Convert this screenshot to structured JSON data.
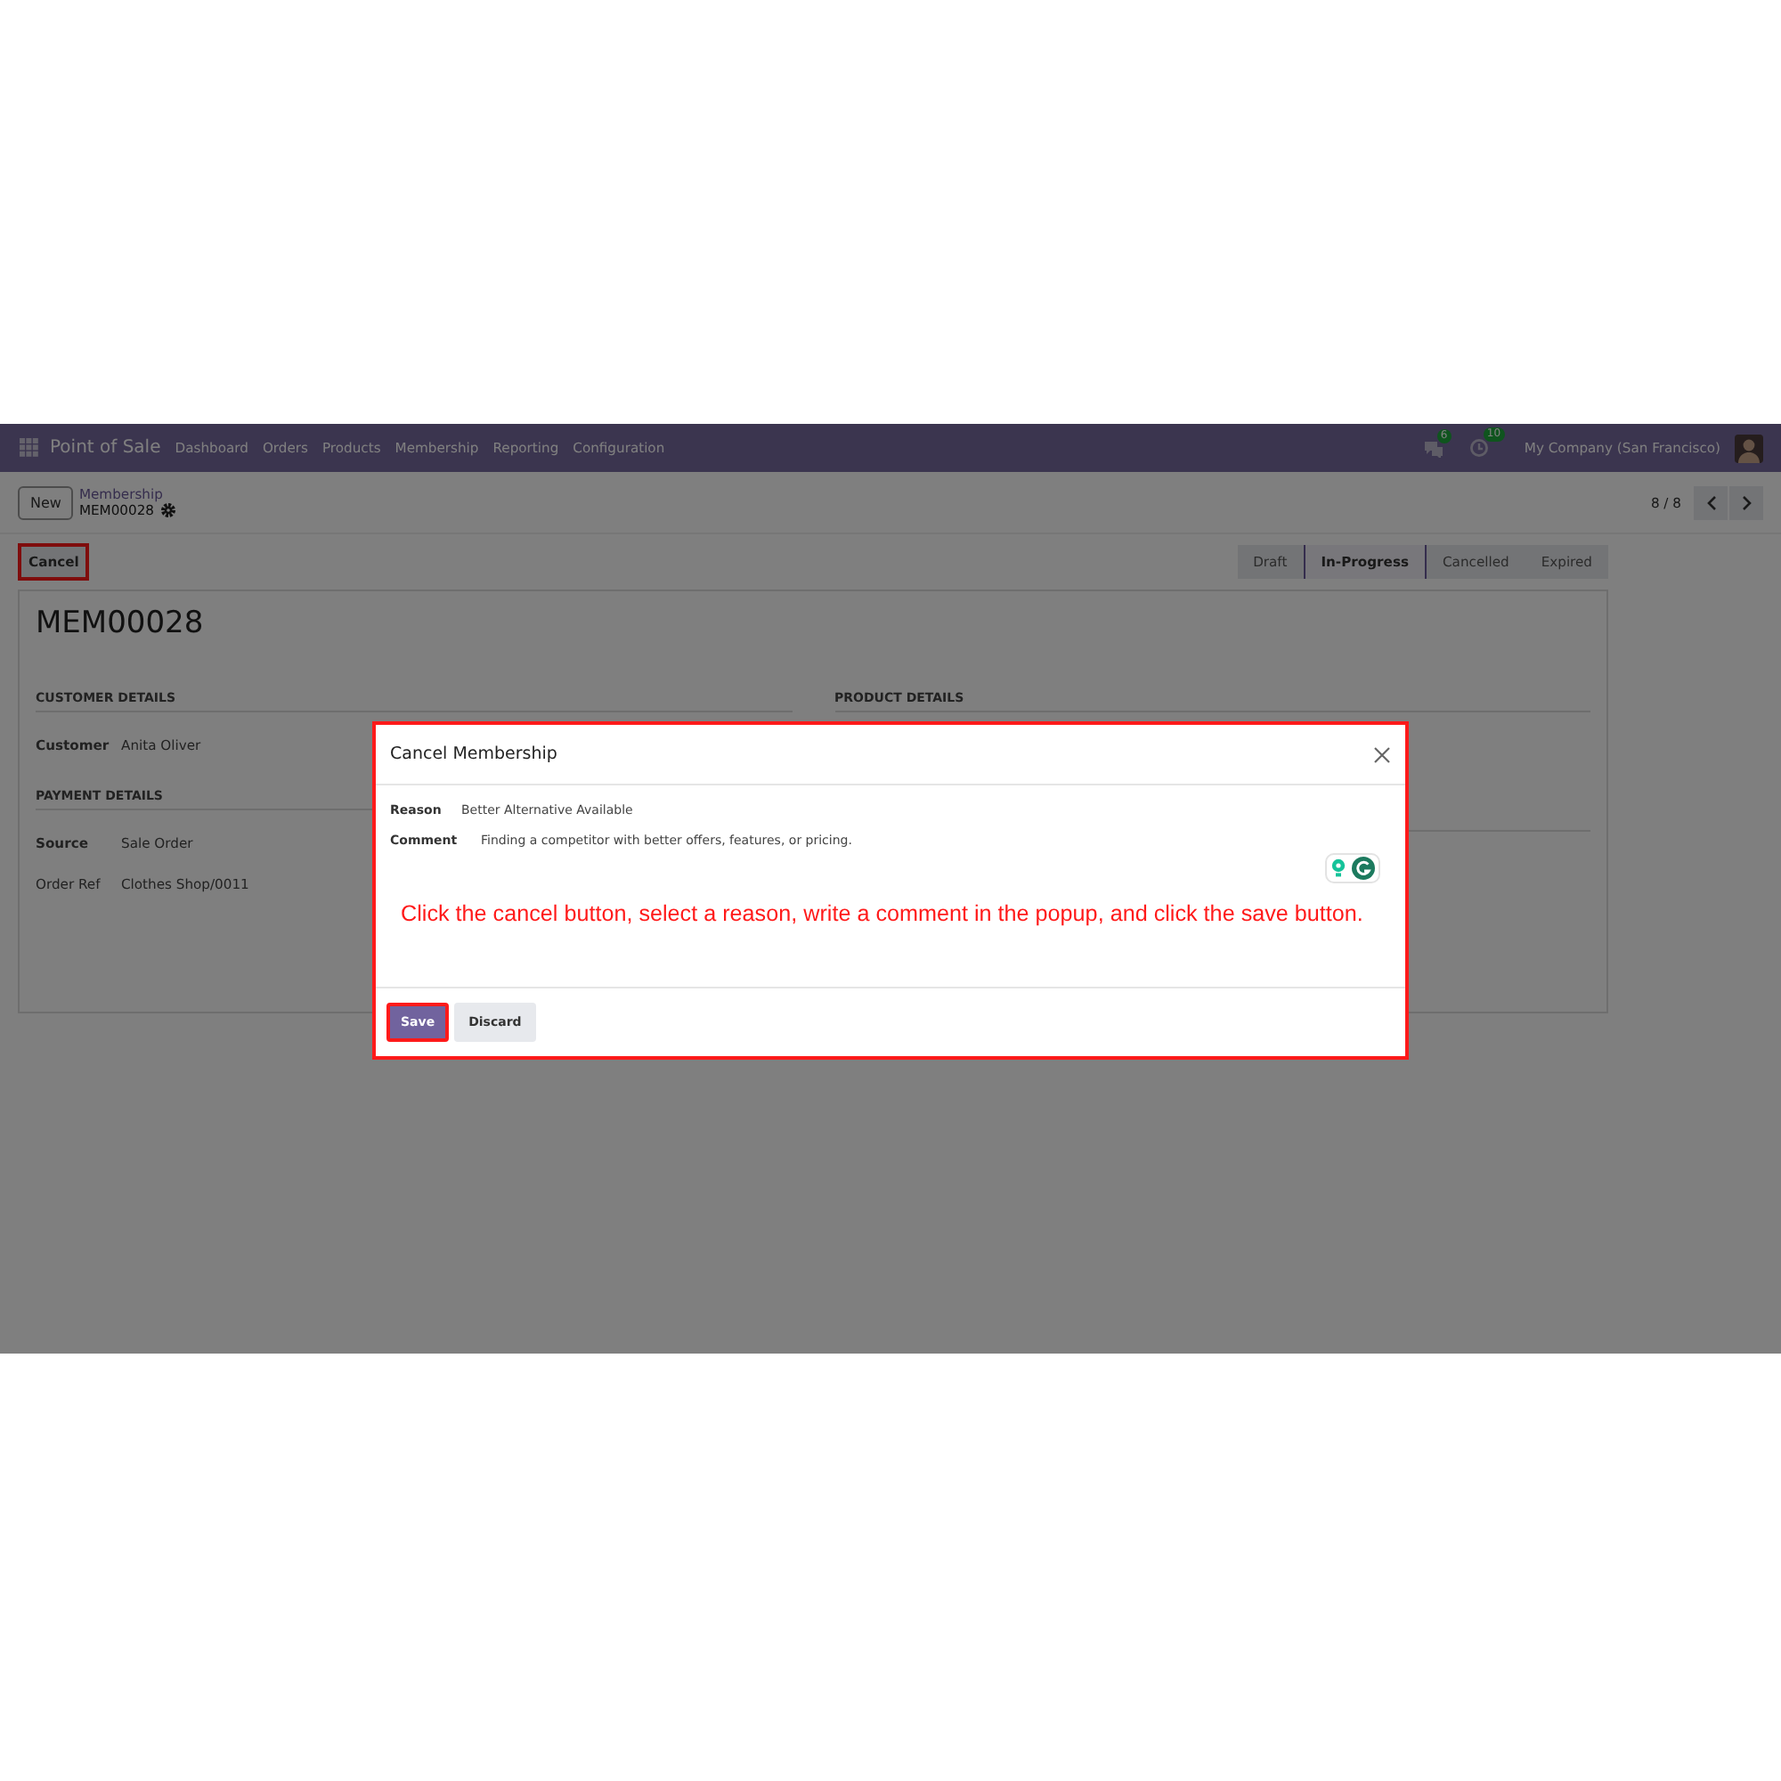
{
  "navbar": {
    "app_name": "Point of Sale",
    "menu": [
      "Dashboard",
      "Orders",
      "Products",
      "Membership",
      "Reporting",
      "Configuration"
    ],
    "messages_count": "6",
    "activities_count": "10",
    "company": "My Company (San Francisco)"
  },
  "control_panel": {
    "new_button": "New",
    "breadcrumb": "Membership",
    "record": "MEM00028",
    "pager": "8 / 8"
  },
  "actions": [
    {
      "label": "Cancel",
      "highlighted": true
    }
  ],
  "statusbar": [
    {
      "label": "Draft",
      "selected": false
    },
    {
      "label": "In-Progress",
      "selected": true
    },
    {
      "label": "Cancelled",
      "selected": false
    },
    {
      "label": "Expired",
      "selected": false
    }
  ],
  "form": {
    "title": "MEM00028",
    "left_sections": [
      {
        "heading": "CUSTOMER DETAILS",
        "fields": [
          {
            "label": "Customer",
            "value": "Anita Oliver",
            "kind": "strong"
          }
        ]
      },
      {
        "heading": "PAYMENT DETAILS",
        "fields": [
          {
            "label": "Source",
            "value": "Sale Order",
            "kind": "strong"
          },
          {
            "label": "Order Ref",
            "value": "Clothes Shop/0011",
            "kind": "plain"
          }
        ]
      }
    ],
    "right_sections": [
      {
        "heading": "PRODUCT DETAILS"
      }
    ]
  },
  "dialog": {
    "title": "Cancel Membership",
    "fields": [
      {
        "label": "Reason",
        "value": "Better Alternative Available"
      },
      {
        "label": "Comment",
        "value": "Finding a competitor with better offers, features, or pricing."
      }
    ],
    "instruction": "Click the cancel button, select a reason, write a comment in the popup, and click the save button.",
    "buttons": [
      {
        "label": "Save",
        "kind": "primary",
        "highlighted": true
      },
      {
        "label": "Discard",
        "kind": "secondary",
        "highlighted": false
      }
    ]
  }
}
